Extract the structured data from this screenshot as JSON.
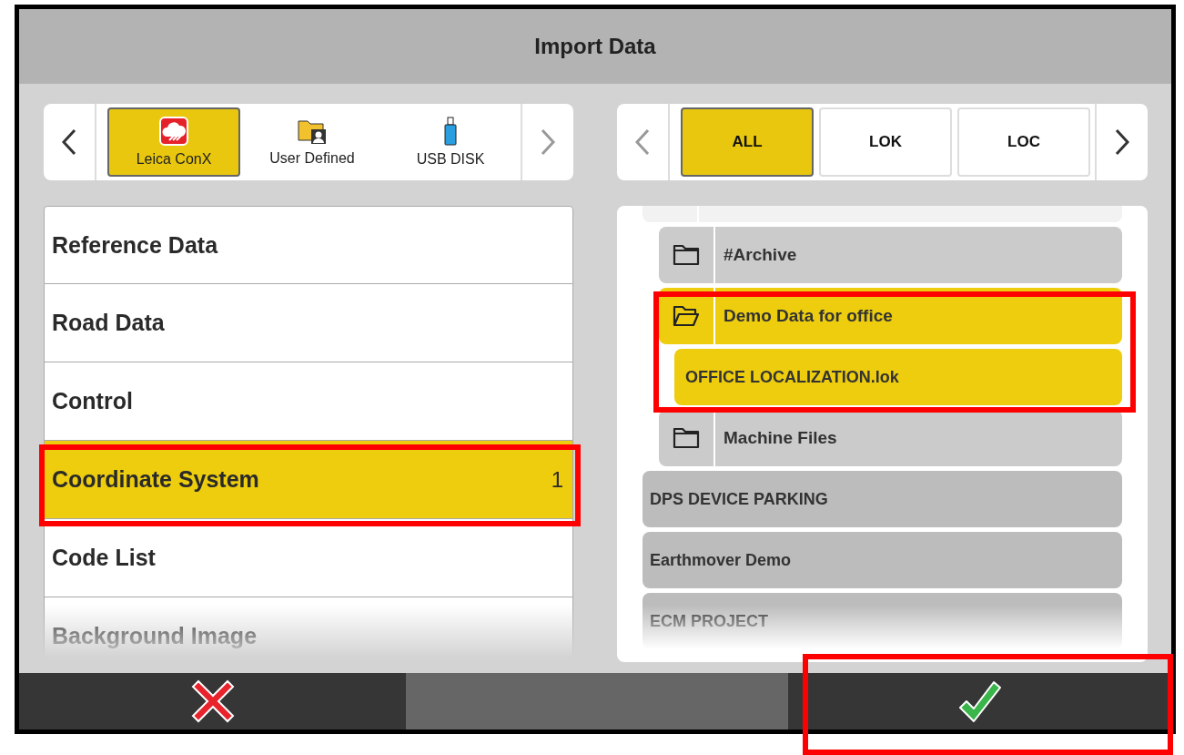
{
  "window": {
    "title": "Import Data"
  },
  "sources": {
    "prev_disabled": false,
    "next_disabled": true,
    "items": [
      {
        "label": "Leica ConX",
        "kind": "cloud",
        "selected": true
      },
      {
        "label": "User Defined",
        "kind": "user-folder",
        "selected": false
      },
      {
        "label": "USB DISK",
        "kind": "usb",
        "selected": false
      }
    ]
  },
  "filters": {
    "prev_disabled": true,
    "next_disabled": false,
    "items": [
      {
        "label": "ALL",
        "selected": true
      },
      {
        "label": "LOK",
        "selected": false
      },
      {
        "label": "LOC",
        "selected": false
      }
    ]
  },
  "categories": [
    {
      "label": "Reference Data",
      "selected": false
    },
    {
      "label": "Road Data",
      "selected": false
    },
    {
      "label": "Control",
      "selected": false
    },
    {
      "label": "Coordinate System",
      "count": "1",
      "selected": true
    },
    {
      "label": "Code List",
      "selected": false
    },
    {
      "label": "Background Image",
      "selected": false
    }
  ],
  "tree": [
    {
      "kind": "project",
      "children": [
        {
          "label": "#Archive",
          "kind": "folder",
          "expanded": false,
          "selected": false
        },
        {
          "label": "Demo Data for office",
          "kind": "folder",
          "expanded": true,
          "selected": true,
          "children": [
            {
              "label": "OFFICE LOCALIZATION.lok",
              "kind": "file",
              "selected": true
            }
          ]
        },
        {
          "label": "Machine Files",
          "kind": "folder",
          "expanded": false,
          "selected": false
        }
      ]
    },
    {
      "label": "DPS DEVICE PARKING",
      "kind": "project",
      "selected": false
    },
    {
      "label": "Earthmover Demo",
      "kind": "project",
      "selected": false
    },
    {
      "label": "ECM PROJECT",
      "kind": "project",
      "selected": false
    }
  ],
  "actions": [
    {
      "kind": "cancel"
    },
    {
      "kind": "blank"
    },
    {
      "kind": "confirm"
    }
  ]
}
